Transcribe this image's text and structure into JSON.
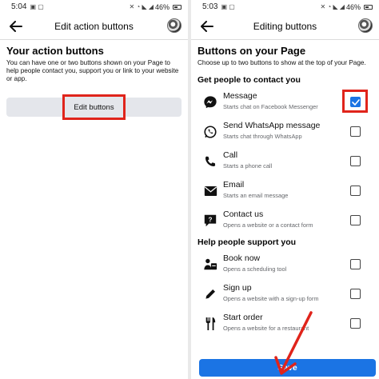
{
  "left": {
    "status": {
      "time": "5:04",
      "battery": "46%"
    },
    "title": "Edit action buttons",
    "section_title": "Your action buttons",
    "description": "You can have one or two buttons shown on your Page to help people contact you, support you or link to your website or app.",
    "edit_button_label": "Edit buttons"
  },
  "right": {
    "status": {
      "time": "5:03",
      "battery": "46%"
    },
    "title": "Editing buttons",
    "section_title": "Buttons on your Page",
    "description": "Choose up to two buttons to show at the top of your Page.",
    "group_contact": "Get people to contact you",
    "group_support": "Help people support you",
    "options": [
      {
        "label": "Message",
        "sub": "Starts chat on Facebook Messenger",
        "icon": "messenger-icon",
        "checked": true
      },
      {
        "label": "Send WhatsApp message",
        "sub": "Starts chat through WhatsApp",
        "icon": "whatsapp-icon",
        "checked": false
      },
      {
        "label": "Call",
        "sub": "Starts a phone call",
        "icon": "phone-icon",
        "checked": false
      },
      {
        "label": "Email",
        "sub": "Starts an email message",
        "icon": "email-icon",
        "checked": false
      },
      {
        "label": "Contact us",
        "sub": "Opens a website or a contact form",
        "icon": "contact-chat-icon",
        "checked": false
      },
      {
        "label": "Book now",
        "sub": "Opens a scheduling tool",
        "icon": "booking-icon",
        "checked": false
      },
      {
        "label": "Sign up",
        "sub": "Opens a website with a sign-up form",
        "icon": "pencil-icon",
        "checked": false
      },
      {
        "label": "Start order",
        "sub": "Opens a website for a restaurant",
        "icon": "fork-knife-icon",
        "checked": false
      }
    ],
    "save_label": "Save"
  },
  "colors": {
    "primary": "#1b74e4",
    "highlight": "#e0241b",
    "button_gray": "#e4e6eb"
  }
}
